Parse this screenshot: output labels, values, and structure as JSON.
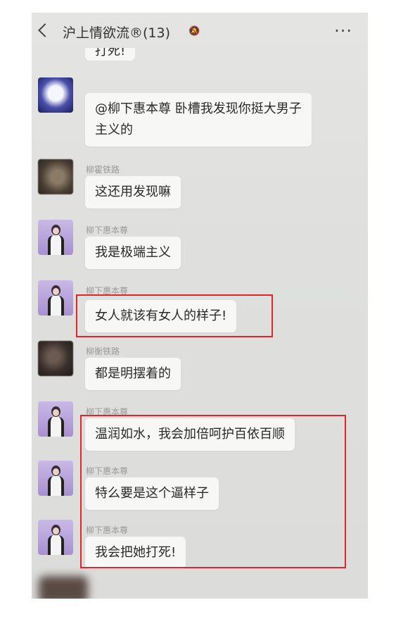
{
  "header": {
    "title": "沪上情欲流®(13)"
  },
  "top_partial_bubble": "打死!",
  "messages": [
    {
      "sender": "",
      "text": "@柳下惠本尊  卧槽我发现你挺大男子主义的",
      "avatar": "sky-icon"
    },
    {
      "sender": "柳霍铁路",
      "text": "这还用发现嘛",
      "avatar": "brown-avatar-icon"
    },
    {
      "sender": "柳下惠本尊",
      "text": "我是极端主义",
      "avatar": "woman-avatar-icon"
    },
    {
      "sender": "柳下惠本尊",
      "text": "女人就该有女人的样子!",
      "avatar": "woman-avatar-icon"
    },
    {
      "sender": "柳衡铁路",
      "text": "都是明摆着的",
      "avatar": "dark-avatar-icon"
    },
    {
      "sender": "柳下惠本尊",
      "text": "温润如水，我会加倍呵护百依百顺",
      "avatar": "woman-avatar-icon"
    },
    {
      "sender": "柳下惠本尊",
      "text": "特么要是这个逼样子",
      "avatar": "woman-avatar-icon"
    },
    {
      "sender": "柳下惠本尊",
      "text": "我会把她打死!",
      "avatar": "woman-avatar-icon"
    }
  ],
  "colors": {
    "highlight": "#e0262b",
    "bubble": "#f7f7f6",
    "background": "#dfe0de"
  }
}
